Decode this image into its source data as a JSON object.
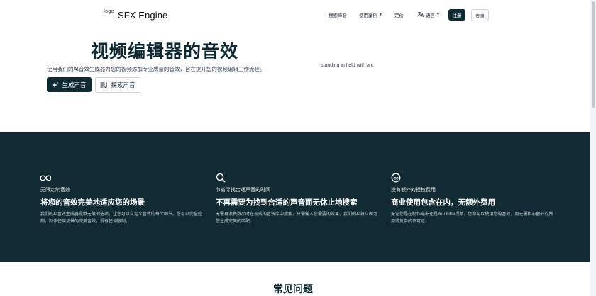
{
  "nav": {
    "logo_alt": "logo",
    "brand": "SFX Engine",
    "links": [
      "搜索声音",
      "使用案例",
      "定价",
      "语言"
    ],
    "signup": "注册",
    "login": "登录"
  },
  "hero": {
    "title": "视频编辑器的音效",
    "subtitle": "使用我们的AI音效生成器为您的视频添加专业质量的音效，旨在提升您的视频编辑工作流程。",
    "marquee_text": "standing in field with a c",
    "generate_button": "生成声音",
    "explore_button": "探索声音"
  },
  "features": [
    {
      "icon": "infinity-icon",
      "label": "无限定制音效",
      "title": "将您的音效完美地适应您的场景",
      "desc": "我们的AI音效生成器提供无限的选项，让您可以自定义音效的每个细节。您可以完全控制，制作任何场景的完美音效，没有任何限制。"
    },
    {
      "icon": "search-icon",
      "label": "节省寻找合适声音的时间",
      "title": "不再需要为找到合适的声音而无休止地搜索",
      "desc": "无需再浪费数小时在现成的音效库中搜索，只需输入您需要的效果，我们的AI将立即为您生成完美的匹配。"
    },
    {
      "icon": "copyright-icon",
      "label": "没有额外的授权费用",
      "title": "商业使用包含在内，无额外费用",
      "desc": "无论您是在制作电影还是YouTube视频，您都可以使用您的音效，而无需担心额外的费用或复杂的许可证。"
    }
  ],
  "faq": {
    "title": "常见问题"
  },
  "colors": {
    "primary": "#0f2a33",
    "features_bg": "#112a33"
  }
}
